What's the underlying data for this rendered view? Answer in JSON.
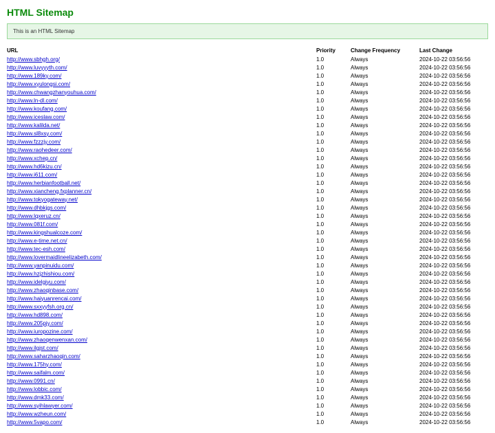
{
  "title": "HTML Sitemap",
  "notice": "This is an HTML Sitemap",
  "headers": {
    "url": "URL",
    "priority": "Priority",
    "frequency": "Change Frequency",
    "last": "Last Change"
  },
  "rows": [
    {
      "url": "http://www.sbhgh.org/",
      "priority": "1.0",
      "freq": "Always",
      "last": "2024-10-22 03:56:56"
    },
    {
      "url": "http://www.luvyyyth.com/",
      "priority": "1.0",
      "freq": "Always",
      "last": "2024-10-22 03:56:56"
    },
    {
      "url": "http://www.189ky.com/",
      "priority": "1.0",
      "freq": "Always",
      "last": "2024-10-22 03:56:56"
    },
    {
      "url": "http://www.xyulongsi.com/",
      "priority": "1.0",
      "freq": "Always",
      "last": "2024-10-22 03:56:56"
    },
    {
      "url": "http://www.chwangzhanyouhua.com/",
      "priority": "1.0",
      "freq": "Always",
      "last": "2024-10-22 03:56:56"
    },
    {
      "url": "http://www.ln-dl.com/",
      "priority": "1.0",
      "freq": "Always",
      "last": "2024-10-22 03:56:56"
    },
    {
      "url": "http://www.koufang.com/",
      "priority": "1.0",
      "freq": "Always",
      "last": "2024-10-22 03:56:56"
    },
    {
      "url": "http://www.iceslaw.com/",
      "priority": "1.0",
      "freq": "Always",
      "last": "2024-10-22 03:56:56"
    },
    {
      "url": "http://www.kalilda.net/",
      "priority": "1.0",
      "freq": "Always",
      "last": "2024-10-22 03:56:56"
    },
    {
      "url": "http://www.sl8xsy.com/",
      "priority": "1.0",
      "freq": "Always",
      "last": "2024-10-22 03:56:56"
    },
    {
      "url": "http://www.fzzzjy.com/",
      "priority": "1.0",
      "freq": "Always",
      "last": "2024-10-22 03:56:56"
    },
    {
      "url": "http://www.raohedeer.com/",
      "priority": "1.0",
      "freq": "Always",
      "last": "2024-10-22 03:56:56"
    },
    {
      "url": "http://www.xchep.cn/",
      "priority": "1.0",
      "freq": "Always",
      "last": "2024-10-22 03:56:56"
    },
    {
      "url": "http://www.hd6kizu.cn/",
      "priority": "1.0",
      "freq": "Always",
      "last": "2024-10-22 03:56:56"
    },
    {
      "url": "http://www.i611.com/",
      "priority": "1.0",
      "freq": "Always",
      "last": "2024-10-22 03:56:56"
    },
    {
      "url": "http://www.herbianfootball.net/",
      "priority": "1.0",
      "freq": "Always",
      "last": "2024-10-22 03:56:56"
    },
    {
      "url": "http://www.xiancheng.fxplanner.cn/",
      "priority": "1.0",
      "freq": "Always",
      "last": "2024-10-22 03:56:56"
    },
    {
      "url": "http://www.tokyogateway.net/",
      "priority": "1.0",
      "freq": "Always",
      "last": "2024-10-22 03:56:56"
    },
    {
      "url": "http://www.dhbkjgs.com/",
      "priority": "1.0",
      "freq": "Always",
      "last": "2024-10-22 03:56:56"
    },
    {
      "url": "http://www.lqxeruz.cn/",
      "priority": "1.0",
      "freq": "Always",
      "last": "2024-10-22 03:56:56"
    },
    {
      "url": "http://www.081f.com/",
      "priority": "1.0",
      "freq": "Always",
      "last": "2024-10-22 03:56:56"
    },
    {
      "url": "http://www.kingshualcoze.com/",
      "priority": "1.0",
      "freq": "Always",
      "last": "2024-10-22 03:56:56"
    },
    {
      "url": "http://www.e-time.net.cn/",
      "priority": "1.0",
      "freq": "Always",
      "last": "2024-10-22 03:56:56"
    },
    {
      "url": "http://www.tec-esh.com/",
      "priority": "1.0",
      "freq": "Always",
      "last": "2024-10-22 03:56:56"
    },
    {
      "url": "http://www.lovermaidlineelizabeth.com/",
      "priority": "1.0",
      "freq": "Always",
      "last": "2024-10-22 03:56:56"
    },
    {
      "url": "http://www.yanpinuidu.com/",
      "priority": "1.0",
      "freq": "Always",
      "last": "2024-10-22 03:56:56"
    },
    {
      "url": "http://www.hzjzhishiou.com/",
      "priority": "1.0",
      "freq": "Always",
      "last": "2024-10-22 03:56:56"
    },
    {
      "url": "http://www.idelgiyu.com/",
      "priority": "1.0",
      "freq": "Always",
      "last": "2024-10-22 03:56:56"
    },
    {
      "url": "http://www.zhaoqinbase.com/",
      "priority": "1.0",
      "freq": "Always",
      "last": "2024-10-22 03:56:56"
    },
    {
      "url": "http://www.haiyuanrencai.com/",
      "priority": "1.0",
      "freq": "Always",
      "last": "2024-10-22 03:56:56"
    },
    {
      "url": "http://www.sxxyyfsh.org.cn/",
      "priority": "1.0",
      "freq": "Always",
      "last": "2024-10-22 03:56:56"
    },
    {
      "url": "http://www.hd898.com/",
      "priority": "1.0",
      "freq": "Always",
      "last": "2024-10-22 03:56:56"
    },
    {
      "url": "http://www.205pjy.com/",
      "priority": "1.0",
      "freq": "Always",
      "last": "2024-10-22 03:56:56"
    },
    {
      "url": "http://www.iuropozine.com/",
      "priority": "1.0",
      "freq": "Always",
      "last": "2024-10-22 03:56:56"
    },
    {
      "url": "http://www.zhaoqenwenxan.com/",
      "priority": "1.0",
      "freq": "Always",
      "last": "2024-10-22 03:56:56"
    },
    {
      "url": "http://www.ilgjst.com/",
      "priority": "1.0",
      "freq": "Always",
      "last": "2024-10-22 03:56:56"
    },
    {
      "url": "http://www.saharzhaoqin.com/",
      "priority": "1.0",
      "freq": "Always",
      "last": "2024-10-22 03:56:56"
    },
    {
      "url": "http://www.175hy.com/",
      "priority": "1.0",
      "freq": "Always",
      "last": "2024-10-22 03:56:56"
    },
    {
      "url": "http://www.saifalm.com/",
      "priority": "1.0",
      "freq": "Always",
      "last": "2024-10-22 03:56:56"
    },
    {
      "url": "http://www.0991.cn/",
      "priority": "1.0",
      "freq": "Always",
      "last": "2024-10-22 03:56:56"
    },
    {
      "url": "http://www.lobbic.com/",
      "priority": "1.0",
      "freq": "Always",
      "last": "2024-10-22 03:56:56"
    },
    {
      "url": "http://www.dmk33.com/",
      "priority": "1.0",
      "freq": "Always",
      "last": "2024-10-22 03:56:56"
    },
    {
      "url": "http://www.syihlawyer.com/",
      "priority": "1.0",
      "freq": "Always",
      "last": "2024-10-22 03:56:56"
    },
    {
      "url": "http://www.wzheun.com/",
      "priority": "1.0",
      "freq": "Always",
      "last": "2024-10-22 03:56:56"
    },
    {
      "url": "http://www.5vapo.com/",
      "priority": "1.0",
      "freq": "Always",
      "last": "2024-10-22 03:56:56"
    }
  ]
}
